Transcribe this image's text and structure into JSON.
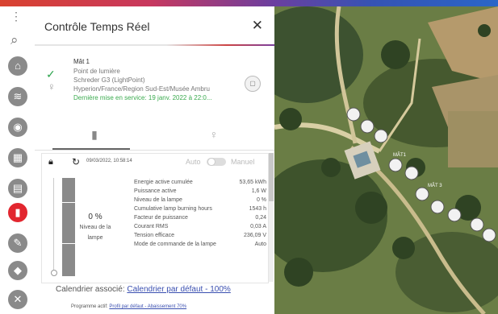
{
  "panel": {
    "title": "Contrôle Temps Réel"
  },
  "asset": {
    "name": "Mât 1",
    "type": "Point de lumière",
    "model": "Schreder G3 (LightPoint)",
    "location": "Hyperion/France/Region Sud-Est/Musée Ambru",
    "commissioning": "Dernière mise en service: 19 janv. 2022 à 22:0..."
  },
  "control": {
    "timestamp": "09/03/2022, 10:58:14",
    "auto_label": "Auto",
    "manual_label": "Manuel",
    "dim_level_percent": 0,
    "level_value": "0 %",
    "level_label": "Niveau de la lampe"
  },
  "measurements": [
    {
      "label": "Energie active cumulée",
      "value": "53,65 kWh"
    },
    {
      "label": "Puissance active",
      "value": "1,6 W"
    },
    {
      "label": "Niveau de la lampe",
      "value": "0 %"
    },
    {
      "label": "Cumulative lamp burning hours",
      "value": "1543 h"
    },
    {
      "label": "Facteur de puissance",
      "value": "0,24"
    },
    {
      "label": "Courant RMS",
      "value": "0,03 A"
    },
    {
      "label": "Tension efficace",
      "value": "236,09 V"
    },
    {
      "label": "Mode de commande de la lampe",
      "value": "Auto"
    }
  ],
  "calendar": {
    "label": "Calendrier associé:",
    "value": "Calendrier par défaut - 100%"
  },
  "program": {
    "label": "Programme actif:",
    "value": "Profil par défaut - Abaissement 70%"
  },
  "map": {
    "labels": [
      "MÂT1",
      "MÂT 3"
    ]
  },
  "colors": {
    "accent_red": "#e2262f",
    "link": "#3a4fb0",
    "status_green": "#3bab4f"
  },
  "icons": {
    "rail": [
      "collapse-icon",
      "search-icon",
      "home-icon",
      "layers-icon",
      "location-icon",
      "dashboard-icon",
      "report-icon",
      "lamp-icon",
      "wrench-icon",
      "tag-icon",
      "tools-icon"
    ]
  }
}
